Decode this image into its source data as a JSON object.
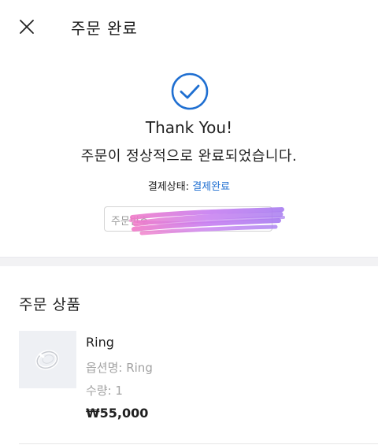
{
  "header": {
    "title": "주문 완료",
    "close_icon": "close-icon"
  },
  "confirmation": {
    "icon": "check-circle-icon",
    "icon_color": "#1f6fd1",
    "thanks": "Thank You!",
    "message": "주문이 정상적으로 완료되었습니다.",
    "payment_label": "결제상태:",
    "payment_status": "결제완료",
    "payment_status_color": "#1f6fd1",
    "order_number_label": "주문번호"
  },
  "order_items": {
    "section_title": "주문 상품",
    "items": [
      {
        "image_icon": "ring-image",
        "name": "Ring",
        "option": "옵션명: Ring",
        "quantity": "수량: 1",
        "price": "₩55,000"
      }
    ]
  }
}
